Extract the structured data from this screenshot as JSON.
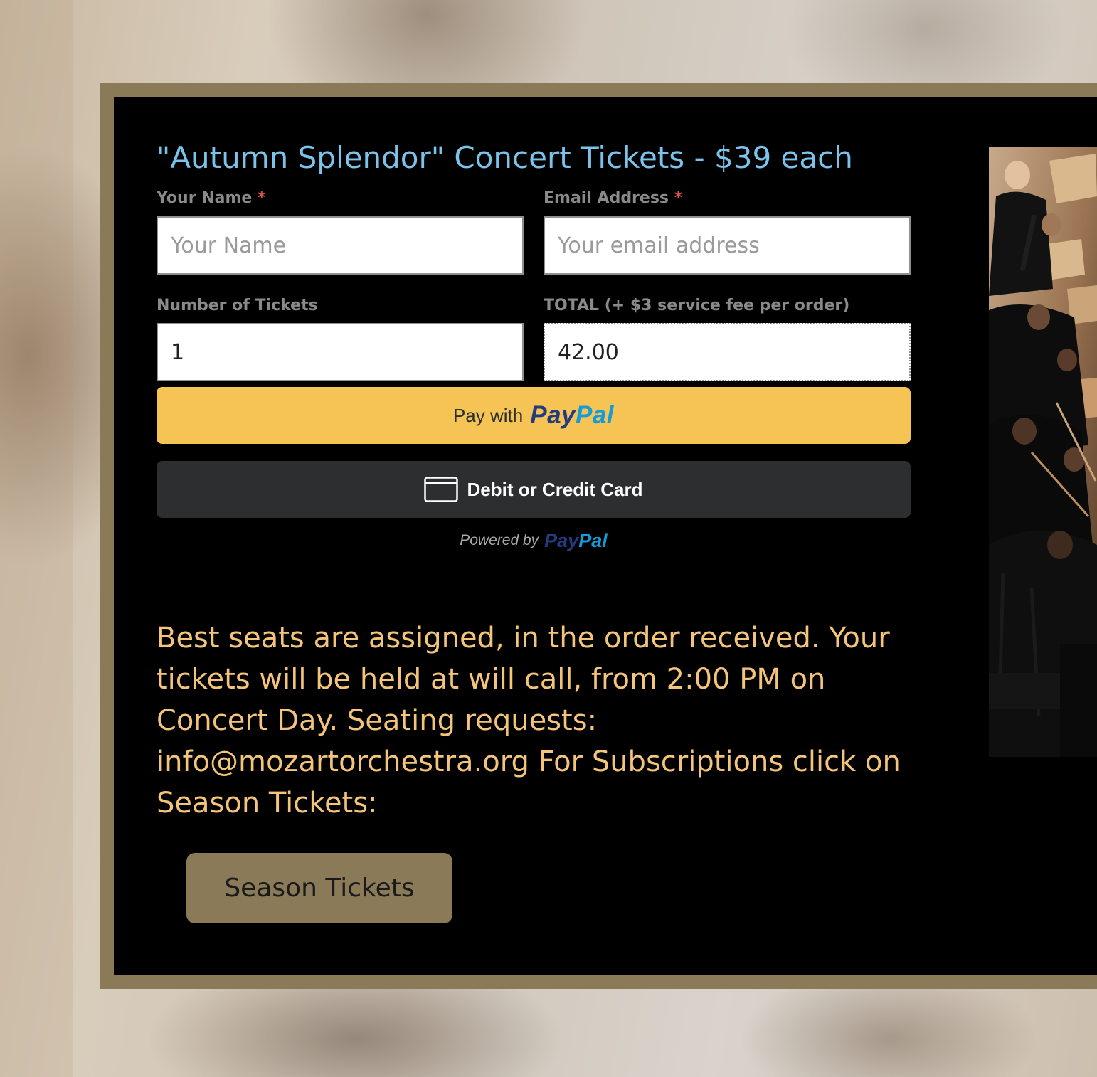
{
  "form": {
    "title": "\"Autumn Splendor\" Concert Tickets - $39 each",
    "name_label": "Your Name",
    "name_required_mark": "*",
    "name_placeholder": "Your Name",
    "email_label": "Email Address",
    "email_required_mark": "*",
    "email_placeholder": "Your email address",
    "tickets_label": "Number of Tickets",
    "tickets_value": "1",
    "total_label": "TOTAL (+ $3 service fee per order)",
    "total_value": "42.00"
  },
  "paypal": {
    "pay_with_text": "Pay with",
    "logo_pay": "Pay",
    "logo_pal": "Pal",
    "card_button_label": "Debit or Credit Card",
    "card_icon": "credit-card-icon",
    "powered_by_text": "Powered by"
  },
  "info": {
    "text": "Best seats are assigned, in the order received. Your tickets will be held at will call, from 2:00 PM on Concert Day. Seating requests: info@mozartorchestra.org For Subscriptions click on Season Tickets:"
  },
  "season_button": {
    "label": "Season Tickets"
  },
  "colors": {
    "panel_border": "#8a7a58",
    "title": "#7cc3eb",
    "info_text": "#f3c47a",
    "paypal_yellow": "#f5c455",
    "paypal_dark_blue": "#253b80",
    "paypal_light_blue": "#179bd7",
    "card_button": "#2c2e2f"
  }
}
